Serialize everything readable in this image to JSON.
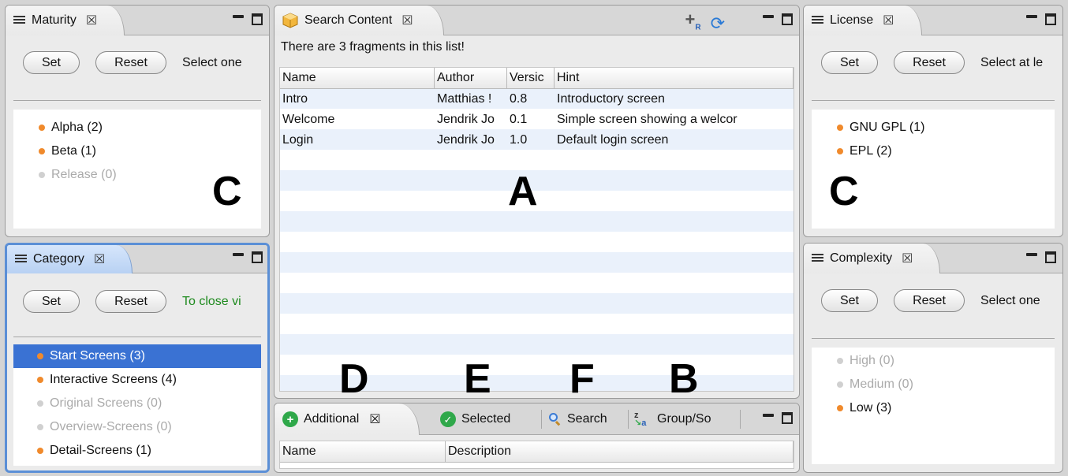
{
  "maturity": {
    "title": "Maturity",
    "set_label": "Set",
    "reset_label": "Reset",
    "hint": "Select one",
    "items": [
      {
        "label": "Alpha (2)",
        "enabled": true
      },
      {
        "label": "Beta (1)",
        "enabled": true
      },
      {
        "label": "Release (0)",
        "enabled": false
      }
    ],
    "marker": "C"
  },
  "category": {
    "title": "Category",
    "set_label": "Set",
    "reset_label": "Reset",
    "hint": "To close vi",
    "items": [
      {
        "label": "Start Screens (3)",
        "enabled": true,
        "selected": true
      },
      {
        "label": "Interactive Screens (4)",
        "enabled": true
      },
      {
        "label": "Original Screens (0)",
        "enabled": false
      },
      {
        "label": "Overview-Screens (0)",
        "enabled": false
      },
      {
        "label": "Detail-Screens (1)",
        "enabled": true
      }
    ]
  },
  "search_content": {
    "title": "Search Content",
    "info": "There are 3 fragments in this list!",
    "columns": [
      "Name",
      "Author",
      "Versic",
      "Hint"
    ],
    "rows": [
      [
        "Intro",
        "Matthias !",
        "0.8",
        "Introductory screen"
      ],
      [
        "Welcome",
        "Jendrik Jo",
        "0.1",
        "Simple screen showing a welcor"
      ],
      [
        "Login",
        "Jendrik Jo",
        "1.0",
        "Default login screen"
      ]
    ],
    "marker": "A"
  },
  "markers": {
    "d": "D",
    "e": "E",
    "f": "F",
    "b": "B"
  },
  "bottom_panel": {
    "tabs": [
      "Additional",
      "Selected",
      "Search",
      "Group/So"
    ],
    "columns": [
      "Name",
      "Description"
    ]
  },
  "license": {
    "title": "License",
    "set_label": "Set",
    "reset_label": "Reset",
    "hint": "Select at le",
    "items": [
      {
        "label": "GNU GPL (1)",
        "enabled": true
      },
      {
        "label": "EPL (2)",
        "enabled": true
      }
    ],
    "marker": "C"
  },
  "complexity": {
    "title": "Complexity",
    "set_label": "Set",
    "reset_label": "Reset",
    "hint": "Select one",
    "items": [
      {
        "label": "High (0)",
        "enabled": false
      },
      {
        "label": "Medium (0)",
        "enabled": false
      },
      {
        "label": "Low (3)",
        "enabled": true
      }
    ]
  },
  "colors": {
    "accent_blue": "#3a72d3",
    "hint_green": "#1e8a1e",
    "enabled_dot": "#f08a2c"
  }
}
